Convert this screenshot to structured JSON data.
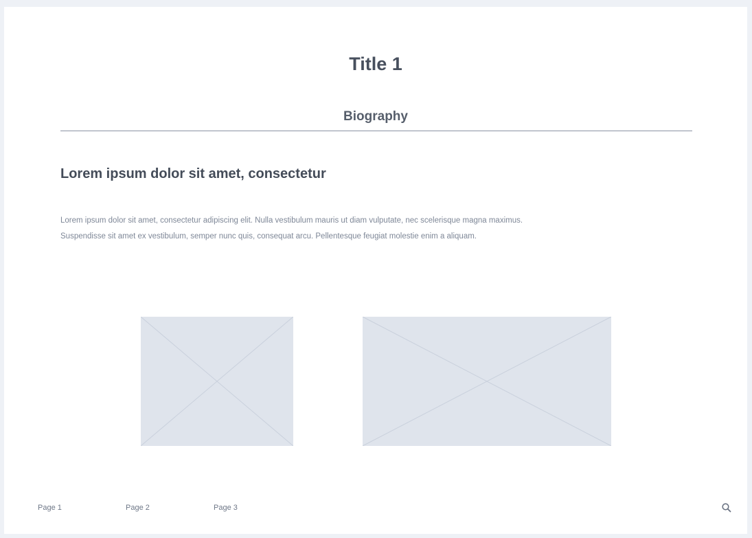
{
  "header": {
    "title": "Title 1",
    "section": "Biography"
  },
  "content": {
    "heading": "Lorem ipsum dolor sit amet, consectetur",
    "paragraph": "Lorem ipsum dolor sit amet, consectetur adipiscing elit. Nulla vestibulum mauris ut diam vulputate, nec scelerisque magna maximus. Suspendisse sit amet ex vestibulum, semper nunc quis, consequat arcu. Pellentesque feugiat molestie enim a aliquam."
  },
  "footer": {
    "links": [
      "Page 1",
      "Page 2",
      "Page 3"
    ],
    "search_icon": "search-icon"
  },
  "colors": {
    "background": "#eef1f6",
    "card": "#ffffff",
    "placeholder_fill": "#dfe4ec",
    "placeholder_lines": "#c9d0dc",
    "divider": "#8a93a3"
  }
}
